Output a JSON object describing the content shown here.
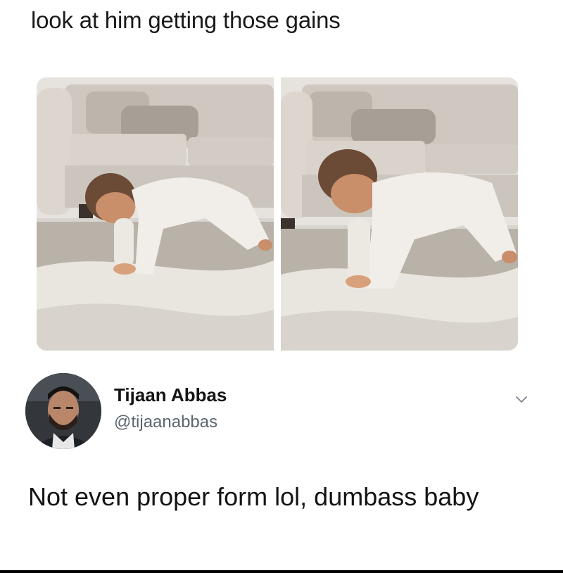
{
  "post": {
    "caption": "look at him getting those gains"
  },
  "tweet": {
    "display_name": "Tijaan Abbas",
    "handle": "@tijaanabbas",
    "text": "Not even proper form lol, dumbass baby"
  },
  "icons": {
    "menu": "chevron-down-icon"
  },
  "colors": {
    "text": "#141414",
    "handle": "#5b6670",
    "chevron": "#8a9299"
  }
}
